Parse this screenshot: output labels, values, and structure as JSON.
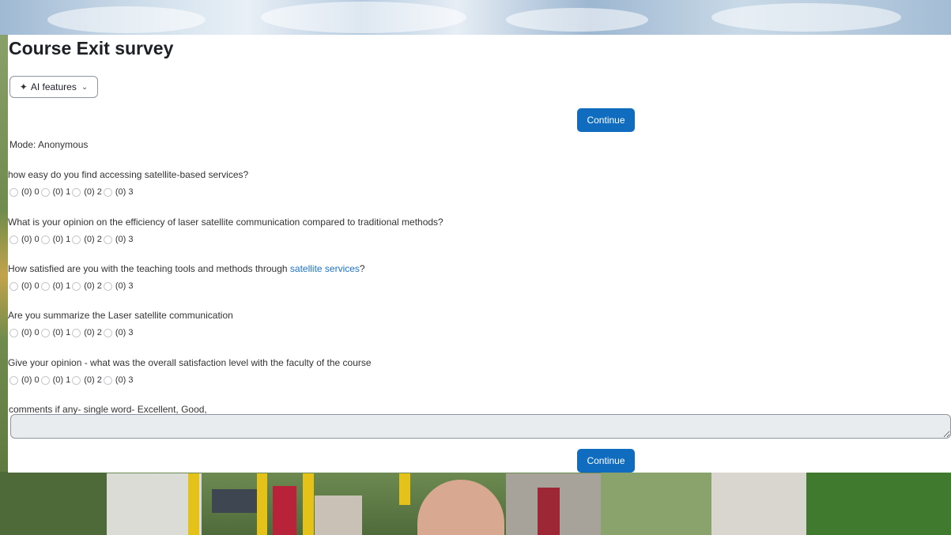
{
  "page": {
    "title": "Course Exit survey",
    "ai_features_label": "AI features",
    "continue_label": "Continue",
    "mode_text": "Mode: Anonymous"
  },
  "questions": [
    {
      "text": "how easy do you find accessing satellite-based services?",
      "options": [
        "(0) 0",
        "(0) 1",
        "(0) 2",
        "(0) 3"
      ]
    },
    {
      "text": "What is your opinion on the efficiency of laser satellite communication compared to traditional methods?",
      "options": [
        "(0) 0",
        "(0) 1",
        "(0) 2",
        "(0) 3"
      ]
    },
    {
      "text": "How satisfied are you with the teaching tools and methods through ",
      "link": "satellite services",
      "suffix": "?",
      "options": [
        "(0) 0",
        "(0) 1",
        "(0) 2",
        "(0) 3"
      ]
    },
    {
      "text": "Are you summarize the Laser satellite communication",
      "options": [
        "(0) 0",
        "(0) 1",
        "(0) 2",
        "(0) 3"
      ]
    },
    {
      "text": "Give your opinion - what was the overall satisfaction level with the faculty of the course",
      "options": [
        "(0) 0",
        "(0) 1",
        "(0) 2",
        "(0) 3"
      ]
    }
  ],
  "comments": {
    "label": "comments if any- single word- Excellent, Good,",
    "value": ""
  },
  "colors": {
    "primary": "#0f6cbf",
    "link": "#1a73c9"
  },
  "icons": {
    "ai": "sparkle-icon",
    "dropdown": "chevron-down-icon"
  }
}
